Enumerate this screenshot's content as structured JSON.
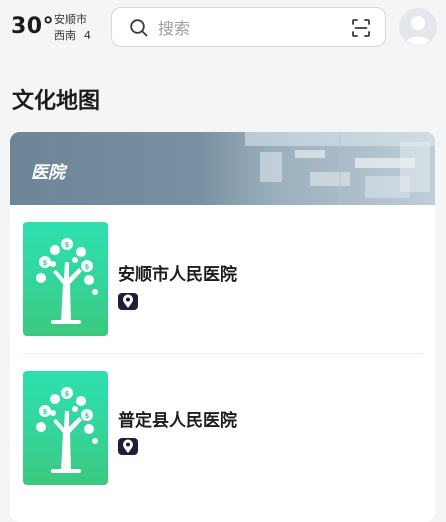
{
  "header": {
    "temperature": "30°",
    "city": "安顺市",
    "wind_direction": "西南",
    "wind_level": "4",
    "search_placeholder": "搜索"
  },
  "page_title": "文化地图",
  "category": {
    "title": "医院"
  },
  "items": [
    {
      "name": "安顺市人民医院",
      "icon": "location-pin-icon"
    },
    {
      "name": "普定县人民医院",
      "icon": "location-pin-icon"
    }
  ],
  "colors": {
    "banner": "#6d8597",
    "thumb_gradient_top": "#2ee0b0",
    "thumb_gradient_bottom": "#3cc97e",
    "pin_badge": "#1b1f3a"
  }
}
